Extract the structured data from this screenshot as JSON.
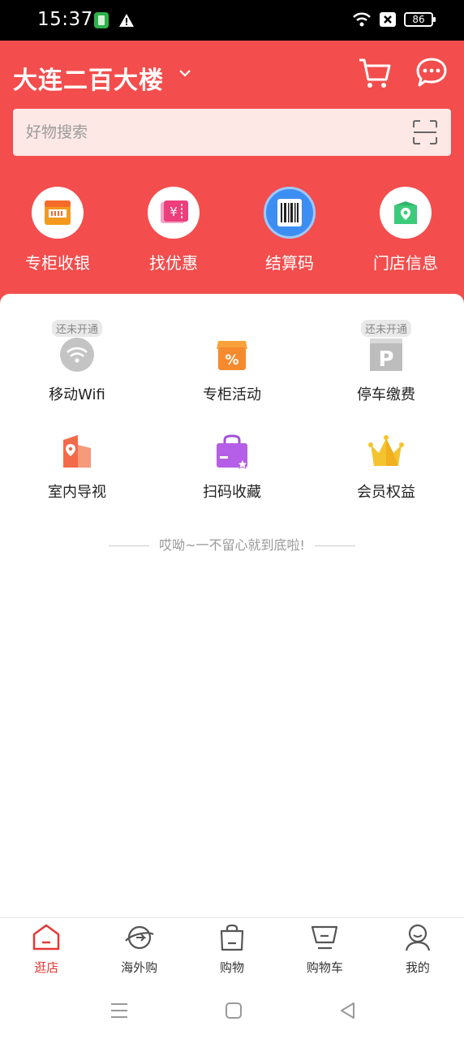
{
  "status_bar": {
    "time": "15:37",
    "battery": "86"
  },
  "header": {
    "store_name": "大连二百大楼",
    "search_placeholder": "好物搜索"
  },
  "quick_actions": [
    {
      "label": "专柜收银",
      "icon": "cashier-icon"
    },
    {
      "label": "找优惠",
      "icon": "coupon-icon"
    },
    {
      "label": "结算码",
      "icon": "barcode-icon"
    },
    {
      "label": "门店信息",
      "icon": "store-location-icon"
    }
  ],
  "services": [
    {
      "label": "移动Wifi",
      "badge": "还未开通",
      "icon": "wifi-icon"
    },
    {
      "label": "专柜活动",
      "badge": "",
      "icon": "discount-shop-icon"
    },
    {
      "label": "停车缴费",
      "badge": "还未开通",
      "icon": "parking-icon"
    },
    {
      "label": "室内导视",
      "badge": "",
      "icon": "indoor-map-icon"
    },
    {
      "label": "扫码收藏",
      "badge": "",
      "icon": "scan-favorite-icon"
    },
    {
      "label": "会员权益",
      "badge": "",
      "icon": "crown-icon"
    }
  ],
  "footer_tip": "哎呦~一不留心就到底啦!",
  "tabs": [
    {
      "label": "逛店",
      "active": true
    },
    {
      "label": "海外购",
      "active": false
    },
    {
      "label": "购物",
      "active": false
    },
    {
      "label": "购物车",
      "active": false
    },
    {
      "label": "我的",
      "active": false
    }
  ],
  "colors": {
    "brand_red": "#f34d4d",
    "active_tab": "#e53935"
  }
}
